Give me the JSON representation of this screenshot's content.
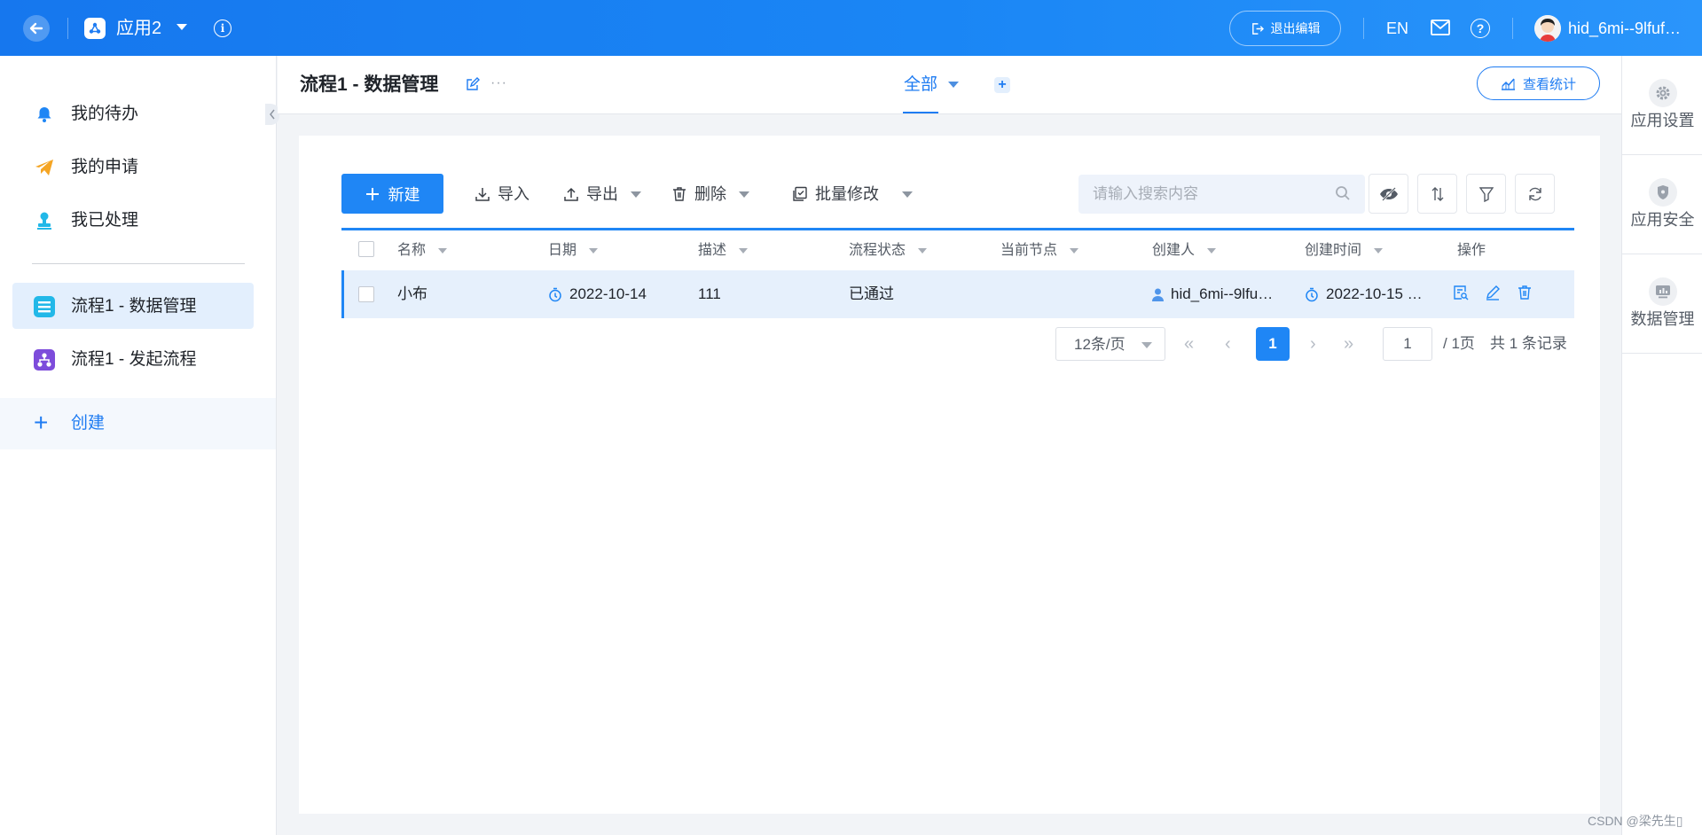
{
  "topbar": {
    "app_name": "应用2",
    "exit_edit": "退出编辑",
    "language": "EN",
    "username": "hid_6mi--9lfuf…"
  },
  "sidebar": {
    "items": [
      {
        "label": "我的待办",
        "icon": "bell-icon"
      },
      {
        "label": "我的申请",
        "icon": "paper-plane-icon"
      },
      {
        "label": "我已处理",
        "icon": "stamp-icon"
      }
    ],
    "forms": [
      {
        "label": "流程1 - 数据管理",
        "icon": "form-icon",
        "active": true
      },
      {
        "label": "流程1 - 发起流程",
        "icon": "flow-icon",
        "active": false
      }
    ],
    "create_label": "创建"
  },
  "header": {
    "title": "流程1 - 数据管理",
    "tab": "全部",
    "stats_label": "查看统计"
  },
  "rail": {
    "items": [
      {
        "label": "应用设置",
        "icon": "gear-icon"
      },
      {
        "label": "应用安全",
        "icon": "shield-icon"
      },
      {
        "label": "数据管理",
        "icon": "chart-icon"
      }
    ]
  },
  "toolbar": {
    "new_label": "新建",
    "import_label": "导入",
    "export_label": "导出",
    "delete_label": "删除",
    "batch_edit_label": "批量修改",
    "search_placeholder": "请输入搜索内容"
  },
  "table": {
    "columns": [
      "名称",
      "日期",
      "描述",
      "流程状态",
      "当前节点",
      "创建人",
      "创建时间",
      "操作"
    ],
    "rows": [
      {
        "name": "小布",
        "date": "2022-10-14",
        "desc": "111",
        "status": "已通过",
        "node": "",
        "creator": "hid_6mi--9lfu…",
        "created": "2022-10-15 …"
      }
    ]
  },
  "pagination": {
    "page_size": "12条/页",
    "current_page": "1",
    "goto_value": "1",
    "total_pages": "/ 1页",
    "total_records": "共 1 条记录"
  },
  "watermark": "CSDN @梁先生▯",
  "colors": {
    "primary": "#1f86f5",
    "active_bg": "#e3effd"
  }
}
